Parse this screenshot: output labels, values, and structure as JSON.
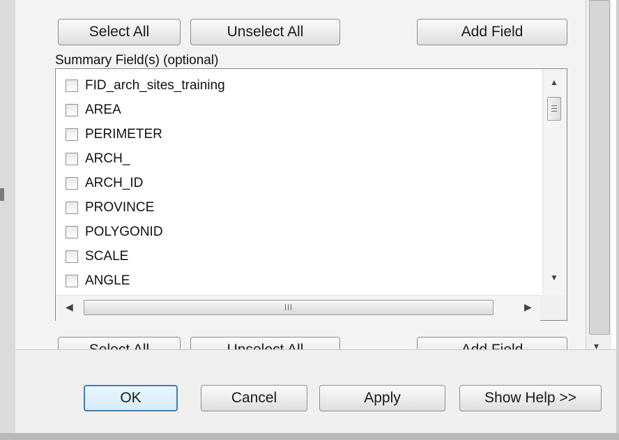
{
  "buttons_top": {
    "select_all": "Select All",
    "unselect_all": "Unselect All",
    "add_field": "Add Field"
  },
  "summary_label": "Summary Field(s) (optional)",
  "fields": [
    {
      "label": "FID_arch_sites_training",
      "checked": false
    },
    {
      "label": "AREA",
      "checked": false
    },
    {
      "label": "PERIMETER",
      "checked": false
    },
    {
      "label": "ARCH_",
      "checked": false
    },
    {
      "label": "ARCH_ID",
      "checked": false
    },
    {
      "label": "PROVINCE",
      "checked": false
    },
    {
      "label": "POLYGONID",
      "checked": false
    },
    {
      "label": "SCALE",
      "checked": false
    },
    {
      "label": "ANGLE",
      "checked": false
    }
  ],
  "buttons_bottom": {
    "select_all": "Select All",
    "unselect_all": "Unselect All",
    "add_field": "Add Field"
  },
  "dialog_buttons": {
    "ok": "OK",
    "cancel": "Cancel",
    "apply": "Apply",
    "show_help": "Show Help >>"
  },
  "icons": {
    "scroll_up": "▲",
    "scroll_down": "▼",
    "scroll_left": "◀",
    "scroll_right": "▶",
    "outer_scroll_down": "▾"
  }
}
